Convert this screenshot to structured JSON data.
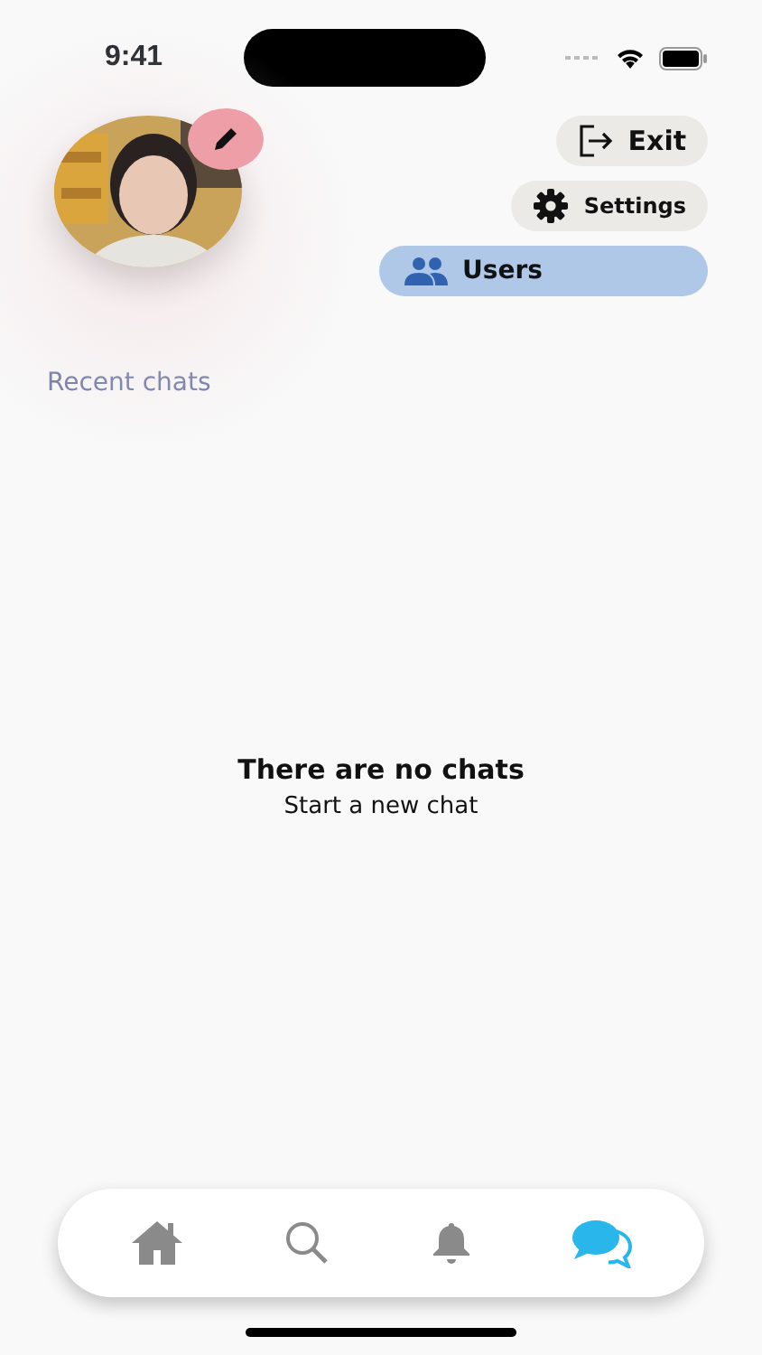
{
  "status_bar": {
    "time": "9:41"
  },
  "actions": [
    {
      "kind": "exit",
      "label": "Exit",
      "selected": false
    },
    {
      "kind": "settings",
      "label": "Settings",
      "selected": false
    },
    {
      "kind": "users",
      "label": "Users",
      "selected": true
    }
  ],
  "section_title": "Recent chats",
  "empty_state": {
    "title": "There are no chats",
    "subtitle": "Start a new chat"
  },
  "tab_bar": [
    {
      "kind": "home",
      "selected": false
    },
    {
      "kind": "search",
      "selected": false
    },
    {
      "kind": "notifications",
      "selected": false
    },
    {
      "kind": "chats",
      "selected": true
    }
  ]
}
